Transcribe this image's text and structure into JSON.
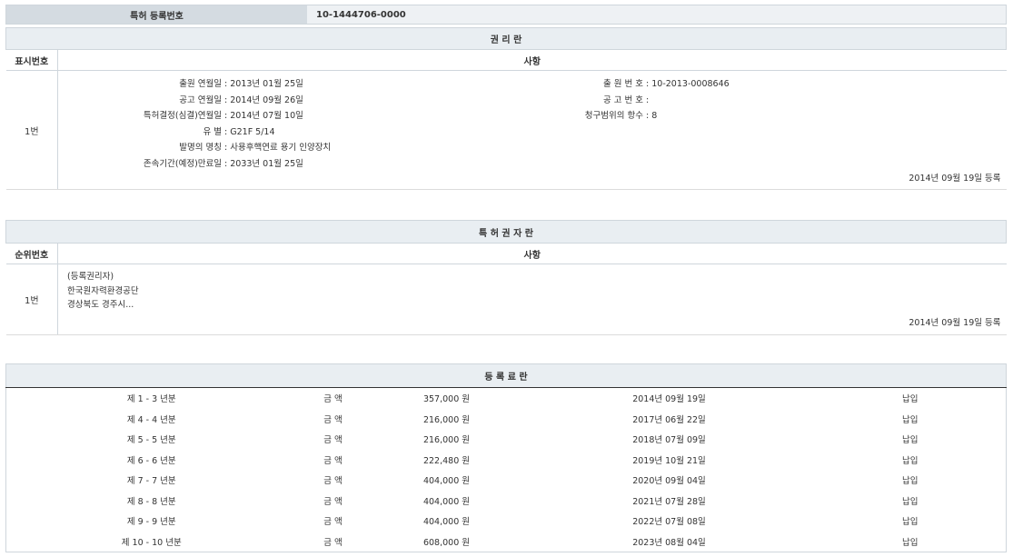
{
  "registration": {
    "label": "특허 등록번호",
    "number": "10-1444706-0000"
  },
  "rights": {
    "title": "권 리 란",
    "col_num": "표시번호",
    "col_item": "사항",
    "row_num": "1번",
    "left_fields": [
      {
        "key": "출원 연월일",
        "value": "2013년 01월 25일"
      },
      {
        "key": "공고 연월일",
        "value": "2014년 09월 26일"
      },
      {
        "key": "특허결정(심결)연월일",
        "value": "2014년 07월 10일"
      },
      {
        "key": "유 별",
        "value": "G21F 5/14"
      },
      {
        "key": "발명의 명칭",
        "value": "사용후핵연료 용기 인양장치"
      },
      {
        "key": "존속기간(예정)만료일",
        "value": "2033년 01월 25일"
      }
    ],
    "right_fields": [
      {
        "key": "출 원 번 호",
        "value": "10-2013-0008646"
      },
      {
        "key": "공 고 번 호",
        "value": ""
      },
      {
        "key": "청구범위의 항수",
        "value": "8"
      }
    ],
    "stamp": "2014년 09월 19일 등록"
  },
  "holder": {
    "title": "특 허 권 자 란",
    "col_num": "순위번호",
    "col_item": "사항",
    "row_num": "1번",
    "lines": [
      "(등록권리자)",
      "한국원자력환경공단",
      "경상북도 경주시..."
    ],
    "stamp": "2014년 09월 19일 등록"
  },
  "fees": {
    "title": "등 록 료 란",
    "rows": [
      {
        "period": "제 1 - 3 년분",
        "label": "금 액",
        "amount": "357,000 원",
        "date": "2014년 09월 19일",
        "status": "납입"
      },
      {
        "period": "제 4 - 4 년분",
        "label": "금 액",
        "amount": "216,000 원",
        "date": "2017년 06월 22일",
        "status": "납입"
      },
      {
        "period": "제 5 - 5 년분",
        "label": "금 액",
        "amount": "216,000 원",
        "date": "2018년 07월 09일",
        "status": "납입"
      },
      {
        "period": "제 6 - 6 년분",
        "label": "금 액",
        "amount": "222,480 원",
        "date": "2019년 10월 21일",
        "status": "납입"
      },
      {
        "period": "제 7 - 7 년분",
        "label": "금 액",
        "amount": "404,000 원",
        "date": "2020년 09월 04일",
        "status": "납입"
      },
      {
        "period": "제 8 - 8 년분",
        "label": "금 액",
        "amount": "404,000 원",
        "date": "2021년 07월 28일",
        "status": "납입"
      },
      {
        "period": "제 9 - 9 년분",
        "label": "금 액",
        "amount": "404,000 원",
        "date": "2022년 07월 08일",
        "status": "납입"
      },
      {
        "period": "제 10 - 10 년분",
        "label": "금 액",
        "amount": "608,000 원",
        "date": "2023년 08월 04일",
        "status": "납입"
      }
    ]
  }
}
